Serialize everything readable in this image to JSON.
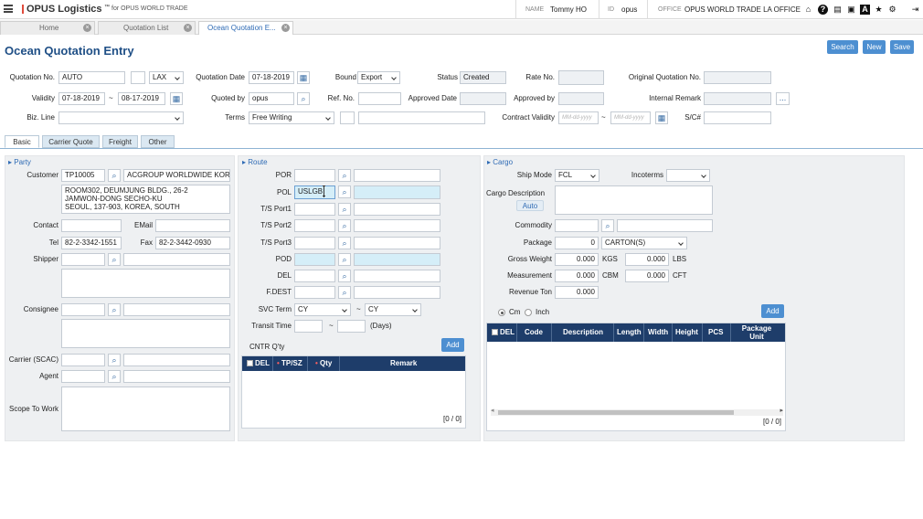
{
  "app": {
    "menu_icon": "hamburger-icon",
    "title": "OPUS Logistics",
    "tm": "™",
    "for": "for OPUS WORLD TRADE"
  },
  "user": {
    "name_label": "NAME",
    "name_value": "Tommy HO",
    "id_label": "ID",
    "id_value": "opus",
    "office_label": "OFFICE",
    "office_value": "OPUS WORLD TRADE LA OFFICE"
  },
  "tabs": [
    {
      "label": "Home"
    },
    {
      "label": "Quotation List"
    },
    {
      "label": "Ocean Quotation E..."
    }
  ],
  "page_title": "Ocean Quotation Entry",
  "actions": {
    "search": "Search",
    "new": "New",
    "save": "Save"
  },
  "form": {
    "quotation_no_label": "Quotation No.",
    "quotation_no": "AUTO",
    "office_code": "LAX",
    "quotation_date_label": "Quotation Date",
    "quotation_date": "07-18-2019",
    "bound_label": "Bound",
    "bound": "Export",
    "status_label": "Status",
    "status": "Created",
    "rate_no_label": "Rate No.",
    "original_quotation_label": "Original Quotation No.",
    "validity_label": "Validity",
    "validity_from": "07-18-2019",
    "validity_sep": "~",
    "validity_to": "08-17-2019",
    "quoted_by_label": "Quoted by",
    "quoted_by": "opus",
    "ref_no_label": "Ref. No.",
    "approved_date_label": "Approved Date",
    "approved_by_label": "Approved by",
    "internal_remark_label": "Internal Remark",
    "more": "...",
    "biz_line_label": "Biz. Line",
    "terms_label": "Terms",
    "terms": "Free Writing",
    "contract_validity_label": "Contract Validity",
    "contract_from_ph": "MM-dd-yyyy",
    "contract_sep": "~",
    "contract_to_ph": "MM-dd-yyyy",
    "sc_label": "S/C#"
  },
  "subtabs": [
    {
      "label": "Basic"
    },
    {
      "label": "Carrier Quote"
    },
    {
      "label": "Freight"
    },
    {
      "label": "Other"
    }
  ],
  "party": {
    "title": "Party",
    "customer_label": "Customer",
    "customer_code": "TP10005",
    "customer_name": "ACGROUP WORLDWIDE KOREA.L",
    "address": [
      "ROOM302, DEUMJUNG BLDG., 26-2",
      "JAMWON-DONG SECHO-KU",
      "SEOUL, 137-903, KOREA, SOUTH"
    ],
    "contact_label": "Contact",
    "email_label": "EMail",
    "tel_label": "Tel",
    "tel": "82-2-3342-1551",
    "fax_label": "Fax",
    "fax": "82-2-3442-0930",
    "shipper_label": "Shipper",
    "consignee_label": "Consignee",
    "carrier_label": "Carrier (SCAC)",
    "agent_label": "Agent",
    "scope_label": "Scope To Work"
  },
  "route": {
    "title": "Route",
    "por_label": "POR",
    "pol_label": "POL",
    "pol_value": "USLGB",
    "ts1_label": "T/S Port1",
    "ts2_label": "T/S Port2",
    "ts3_label": "T/S Port3",
    "pod_label": "POD",
    "del_label": "DEL",
    "fdest_label": "F.DEST",
    "svc_label": "SVC Term",
    "svc_from": "CY",
    "svc_sep": "~",
    "svc_to": "CY",
    "transit_label": "Transit Time",
    "transit_sep": "~",
    "days": "(Days)",
    "cntr_label": "CNTR Q'ty",
    "add": "Add",
    "table_headers": [
      "DEL",
      "TP/SZ",
      "Qty",
      "Remark"
    ],
    "table_count": "[0 / 0]"
  },
  "cargo": {
    "title": "Cargo",
    "ship_mode_label": "Ship Mode",
    "ship_mode": "FCL",
    "incoterms_label": "Incoterms",
    "desc_label": "Cargo Description",
    "auto": "Auto",
    "commodity_label": "Commodity",
    "package_label": "Package",
    "package_qty": "0",
    "package_unit": "CARTON(S)",
    "gross_label": "Gross Weight",
    "gross_kgs": "0.000",
    "kgs": "KGS",
    "gross_lbs": "0.000",
    "lbs": "LBS",
    "meas_label": "Measurement",
    "meas_cbm": "0.000",
    "cbm": "CBM",
    "meas_cft": "0.000",
    "cft": "CFT",
    "revenue_label": "Revenue Ton",
    "revenue": "0.000",
    "unit_cm": "Cm",
    "unit_inch": "Inch",
    "add": "Add",
    "table_headers": [
      "DEL",
      "Code",
      "Description",
      "Length",
      "Width",
      "Height",
      "PCS",
      "Package Unit"
    ],
    "table_count": "[0 / 0]"
  }
}
